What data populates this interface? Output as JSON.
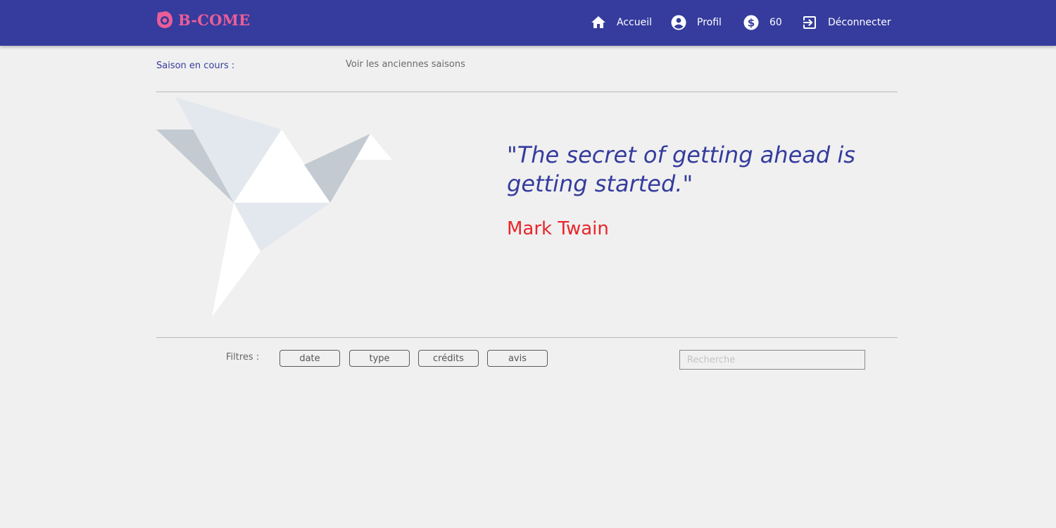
{
  "header": {
    "brand": "B-COME",
    "nav": {
      "home_label": "Accueil",
      "profile_label": "Profil",
      "credits_value": "60",
      "logout_label": "Déconnecter"
    }
  },
  "season": {
    "current_label": "Saison en cours :",
    "old_seasons_link": "Voir les anciennes saisons"
  },
  "quote": {
    "text": "\"The secret of getting ahead is getting started.\"",
    "author": "Mark Twain"
  },
  "filters": {
    "label": "Filtres :",
    "buttons": [
      "date",
      "type",
      "crédits",
      "avis"
    ]
  },
  "search": {
    "placeholder": "Recherche",
    "value": ""
  },
  "colors": {
    "header_bg": "#353c9d",
    "brand": "#ec5d97",
    "quote_text": "#353c9d",
    "author_text": "#e8262a",
    "page_bg": "#f0f0f0"
  },
  "icons": {
    "logo": "b-come-logo-icon",
    "home": "home-icon",
    "profile": "account-circle-icon",
    "credits": "dollar-coin-icon",
    "logout": "logout-icon",
    "illustration": "origami-bird-illustration"
  }
}
